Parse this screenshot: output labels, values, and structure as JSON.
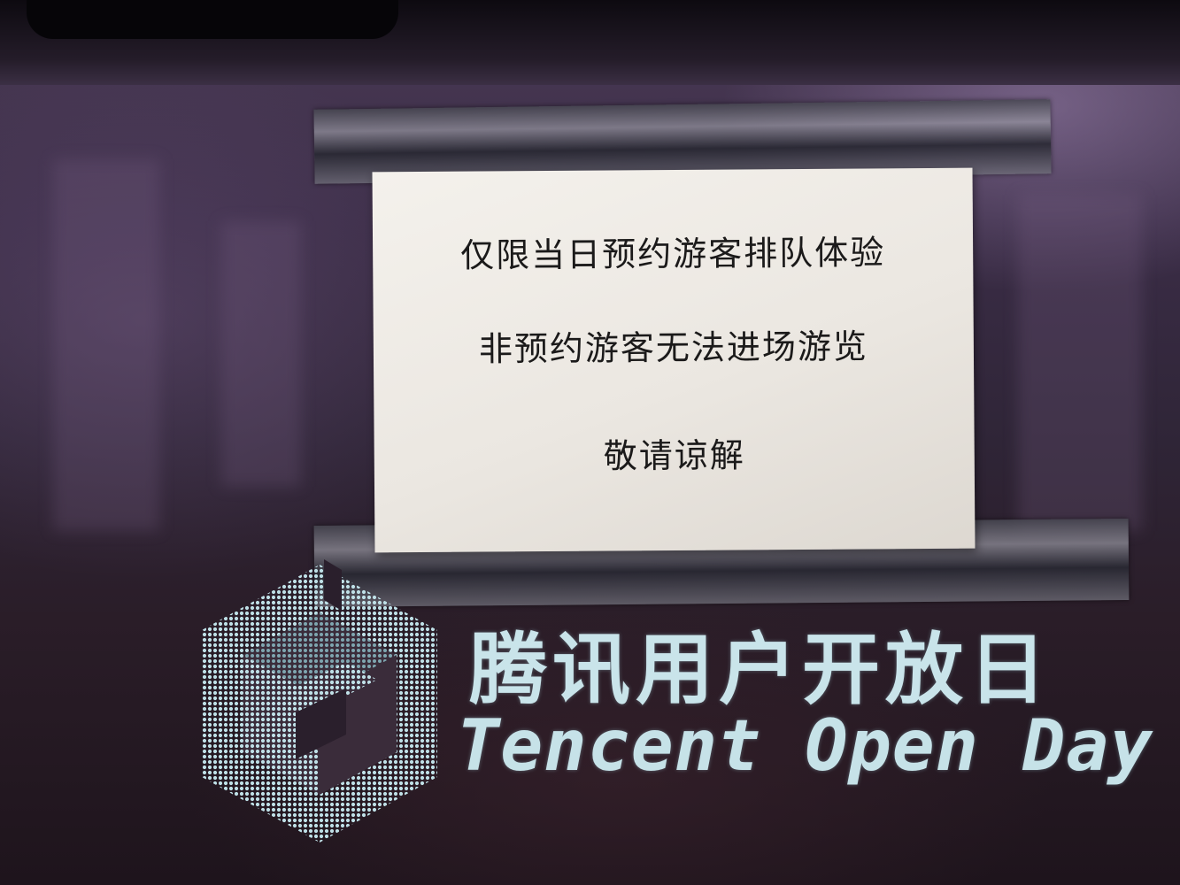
{
  "notice": {
    "lines": [
      "仅限当日预约游客排队体验",
      "非预约游客无法进场游览",
      "敬请谅解"
    ]
  },
  "brand": {
    "logo_icon": "hexagon-cube-logo-icon",
    "name_cn": "腾讯用户开放日",
    "name_en": "Tencent Open Day"
  },
  "colors": {
    "background": "#2f2537",
    "paper": "#efebe5",
    "notice_text": "#1b1a1a",
    "logo": "#c9e4ea"
  }
}
